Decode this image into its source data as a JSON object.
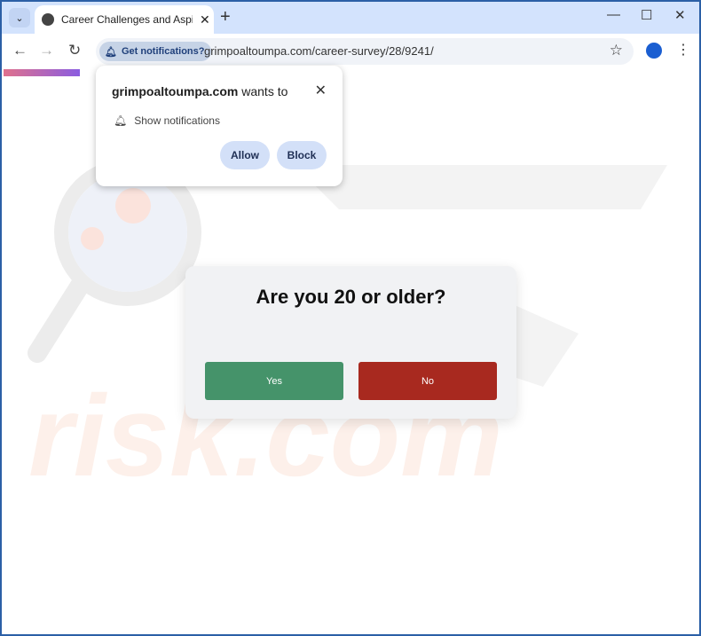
{
  "browser": {
    "tab_title": "Career Challenges and Aspirations",
    "url": "grimpoaltoumpa.com/career-survey/28/9241/",
    "notif_chip": "Get notifications?"
  },
  "permission_popup": {
    "site": "grimpoaltoumpa.com",
    "wants_to": " wants to",
    "permission": "Show notifications",
    "allow": "Allow",
    "block": "Block"
  },
  "page": {
    "progress_percent": 11,
    "question": "Are you 20 or older?",
    "yes": "Yes",
    "no": "No",
    "yes_color": "#45936a",
    "no_color": "#a8291f"
  },
  "watermark": "risk.com"
}
